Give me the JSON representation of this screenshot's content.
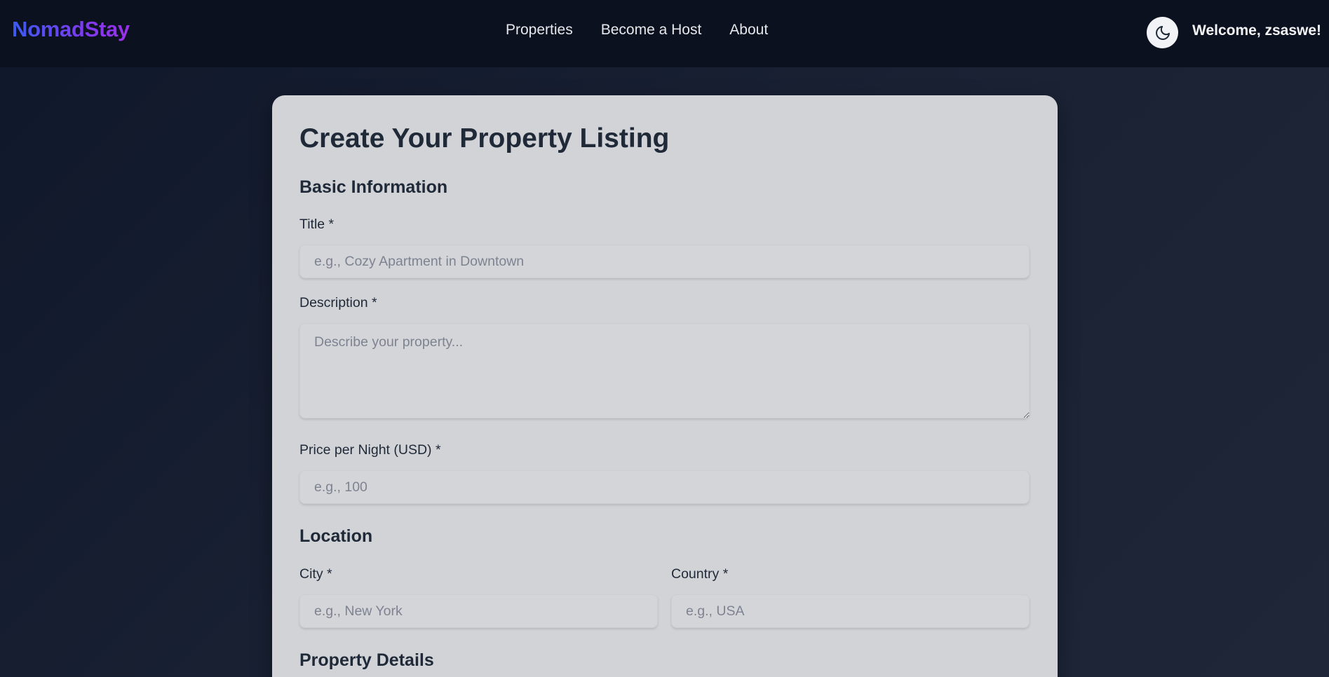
{
  "nav": {
    "brand": "NomadStay",
    "links": [
      "Properties",
      "Become a Host",
      "About"
    ],
    "theme_icon": "moon-icon",
    "welcome": "Welcome, zsaswe!"
  },
  "form": {
    "title": "Create Your Property Listing",
    "sections": {
      "basic": "Basic Information",
      "location": "Location",
      "details": "Property Details"
    },
    "fields": {
      "title": {
        "label": "Title *",
        "placeholder": "e.g., Cozy Apartment in Downtown",
        "value": ""
      },
      "description": {
        "label": "Description *",
        "placeholder": "Describe your property...",
        "value": ""
      },
      "price": {
        "label": "Price per Night (USD) *",
        "placeholder": "e.g., 100",
        "value": ""
      },
      "city": {
        "label": "City *",
        "placeholder": "e.g., New York",
        "value": ""
      },
      "country": {
        "label": "Country *",
        "placeholder": "e.g., USA",
        "value": ""
      }
    }
  },
  "colors": {
    "background": "#0f172a",
    "navbar": "#0c1120",
    "card": "#d1d3d7",
    "text_dark": "#1f2937",
    "brand_gradient_start": "#3b5bf0",
    "brand_gradient_end": "#9b30e8"
  }
}
